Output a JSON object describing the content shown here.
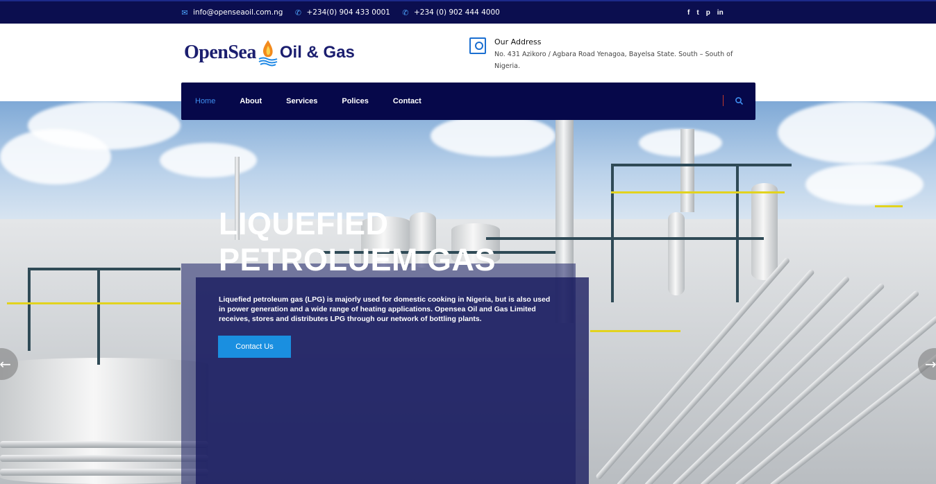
{
  "topbar": {
    "email": "info@openseaoil.com.ng",
    "phone1": "+234(0) 904 433 0001",
    "phone2": "+234 (0) 902 444 4000",
    "social_icons": [
      "facebook-icon",
      "twitter-icon",
      "pinterest-icon",
      "linkedin-icon"
    ],
    "social_glyphs": [
      "f",
      "t",
      "p",
      "in"
    ]
  },
  "logo": {
    "word1": "OpenSea",
    "word2": "Oil & Gas"
  },
  "address": {
    "heading": "Our Address",
    "text": "No. 431 Azikoro / Agbara Road Yenagoa, Bayelsa State. South – South of Nigeria."
  },
  "nav": {
    "items": [
      "Home",
      "About",
      "Services",
      "Polices",
      "Contact"
    ],
    "active": "Home"
  },
  "hero": {
    "title_line1": "LIQUEFIED",
    "title_line2": "PETROLUEM GAS",
    "description": "Liquefied petroleum gas (LPG) is majorly used for domestic cooking in Nigeria, but is also used in power generation and a wide range of heating applications. Opensea Oil and Gas Limited receives, stores and distributes LPG through our network of bottling plants.",
    "cta_label": "Contact Us"
  },
  "colors": {
    "topbar_bg": "#0b0e4f",
    "nav_bg": "#06084a",
    "accent": "#1a8fe0",
    "active_link": "#3f8ff0",
    "logo_text": "#1b1e6f"
  }
}
